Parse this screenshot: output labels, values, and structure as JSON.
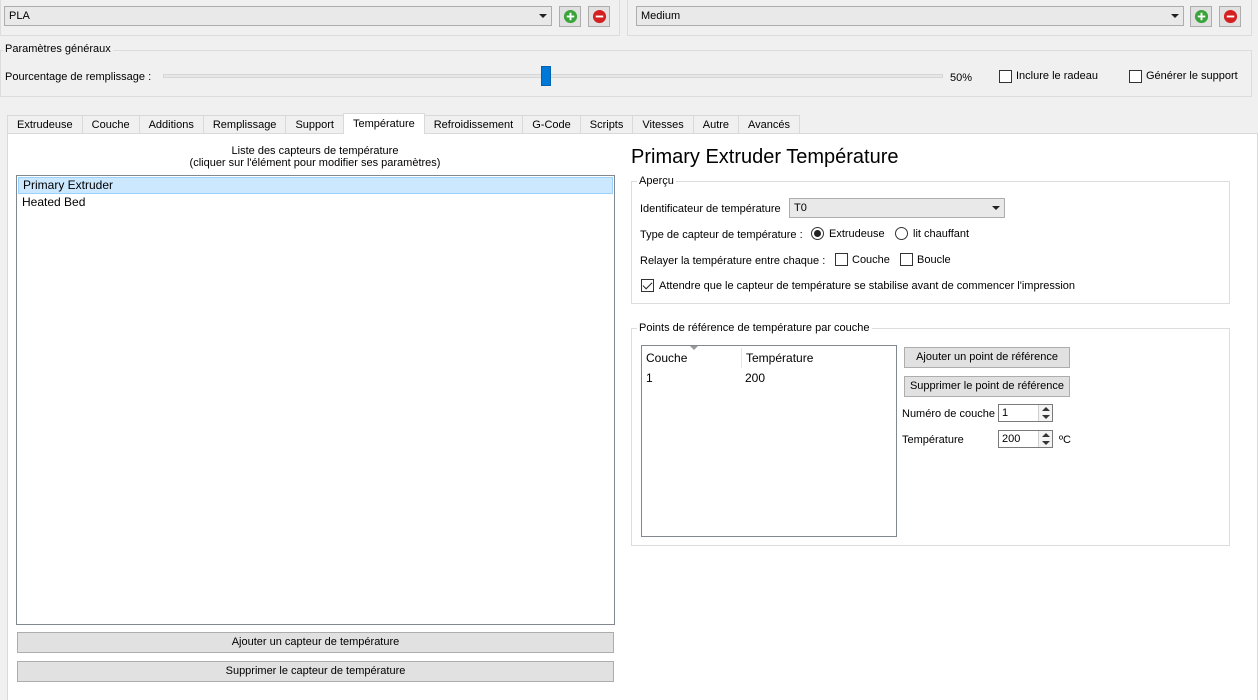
{
  "top": {
    "material_value": "PLA",
    "quality_value": "Medium",
    "add_icon": "plus-circle-icon",
    "remove_icon": "minus-circle-icon",
    "colors": {
      "add": "#3aa33a",
      "remove": "#d42020"
    }
  },
  "general": {
    "title": "Paramètres généraux",
    "infill_label": "Pourcentage de remplissage :",
    "infill_value_text": "50%",
    "infill_fraction": 0.5,
    "raft_label": "Inclure le radeau",
    "support_label": "Générer le support"
  },
  "tabs": [
    {
      "label": "Extrudeuse"
    },
    {
      "label": "Couche"
    },
    {
      "label": "Additions"
    },
    {
      "label": "Remplissage"
    },
    {
      "label": "Support"
    },
    {
      "label": "Température",
      "active": true
    },
    {
      "label": "Refroidissement"
    },
    {
      "label": "G-Code"
    },
    {
      "label": "Scripts"
    },
    {
      "label": "Vitesses"
    },
    {
      "label": "Autre"
    },
    {
      "label": "Avancés"
    }
  ],
  "sensors": {
    "header_line1": "Liste des capteurs de température",
    "header_line2": "(cliquer sur l'élément pour modifier ses paramètres)",
    "items": [
      "Primary Extruder",
      "Heated Bed"
    ],
    "add_button": "Ajouter un capteur de température",
    "remove_button": "Supprimer le capteur de température"
  },
  "detail": {
    "title": "Primary Extruder Température",
    "overview_title": "Aperçu",
    "identifier_label": "Identificateur de température",
    "identifier_value": "T0",
    "sensor_type_label": "Type de capteur de température :",
    "type_extruder": "Extrudeuse",
    "type_bed": "lit chauffant",
    "relay_label": "Relayer la température entre chaque :",
    "relay_layer": "Couche",
    "relay_loop": "Boucle",
    "wait_label": "Attendre que le capteur de température se stabilise avant de commencer l'impression"
  },
  "setpoints": {
    "title": "Points de référence de température par couche",
    "col_layer": "Couche",
    "col_temp": "Température",
    "rows": [
      {
        "layer": "1",
        "temp": "200"
      }
    ],
    "add_button": "Ajouter un point de référence",
    "remove_button": "Supprimer le point de référence",
    "layer_number_label": "Numéro de couche",
    "layer_number_value": "1",
    "temp_label": "Température",
    "temp_value": "200",
    "temp_unit": "ºC"
  }
}
